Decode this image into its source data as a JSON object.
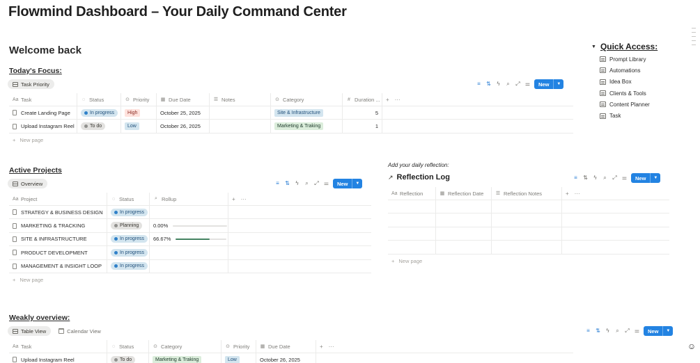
{
  "page_title": "Flowmind Dashboard – Your Daily Command Center",
  "welcome": "Welcome back",
  "colors": {
    "accent": "#2383e2",
    "in_progress_bg": "#d3e5ef",
    "in_progress_dot": "#2f80c9",
    "todo_bg": "#e3e2e0",
    "todo_dot": "#91918e",
    "planning_bg": "#e3e2e0",
    "high_bg": "#ffe2dd",
    "high_fg": "#8b2b22",
    "low_bg": "#d3e5ef",
    "low_fg": "#1f4e79",
    "site_bg": "#d3e5ef",
    "marketing_bg": "#dbeddb"
  },
  "toolbar": {
    "new_label": "New"
  },
  "new_page_label": "New page",
  "focus": {
    "heading": "Today's Focus:",
    "view_tab": "Task Priority",
    "columns": [
      "Task",
      "Status",
      "Priority",
      "Due Date",
      "Notes",
      "Category",
      "Duration ..."
    ],
    "rows": [
      {
        "task": "Create Landing Page",
        "status": "In progress",
        "priority": "High",
        "due": "October 25, 2025",
        "notes": "",
        "category": "Site & Infrastructure",
        "duration": "5"
      },
      {
        "task": "Upload Instagram Reel",
        "status": "To do",
        "priority": "Low",
        "due": "October 26, 2025",
        "notes": "",
        "category": "Marketing & Traking",
        "duration": "1"
      }
    ]
  },
  "projects": {
    "heading": "Active Projects",
    "view_tab": "Overview",
    "columns": [
      "Project",
      "Status",
      "Rollup"
    ],
    "rows": [
      {
        "name": "STRATEGY & BUSINESS DESIGN",
        "status": "In progress",
        "rollup": "",
        "progress": null
      },
      {
        "name": "MARKETING & TRACKING",
        "status": "Planning",
        "rollup": "0.00%",
        "progress": 0.0
      },
      {
        "name": "SITE & INFRASTRUCTURE",
        "status": "In progress",
        "rollup": "66.67%",
        "progress": 0.6667
      },
      {
        "name": "PRODUCT DEVELOPMENT",
        "status": "In progress",
        "rollup": "",
        "progress": null
      },
      {
        "name": "MANAGEMENT & INSIGHT LOOP",
        "status": "In progress",
        "rollup": "",
        "progress": null
      }
    ]
  },
  "reflection": {
    "prompt": "Add your daily reflection:",
    "title": "Reflection Log",
    "columns": [
      "Reflection",
      "Reflection Date",
      "Reflection Notes"
    ]
  },
  "quick_access": {
    "title": "Quick Access:",
    "items": [
      "Prompt Library",
      "Automations",
      "Idea Box",
      "Clients & Tools",
      "Content Planner",
      "Task"
    ]
  },
  "weekly": {
    "heading": "Weakly overview:",
    "tabs": [
      "Table View",
      "Calendar View"
    ],
    "columns": [
      "Task",
      "Status",
      "Category",
      "Priority",
      "Due Date"
    ],
    "rows": [
      {
        "task": "Upload Instagram Reel",
        "status": "To do",
        "category": "Marketing & Traking",
        "priority": "Low",
        "due": "October 26, 2025"
      }
    ]
  }
}
